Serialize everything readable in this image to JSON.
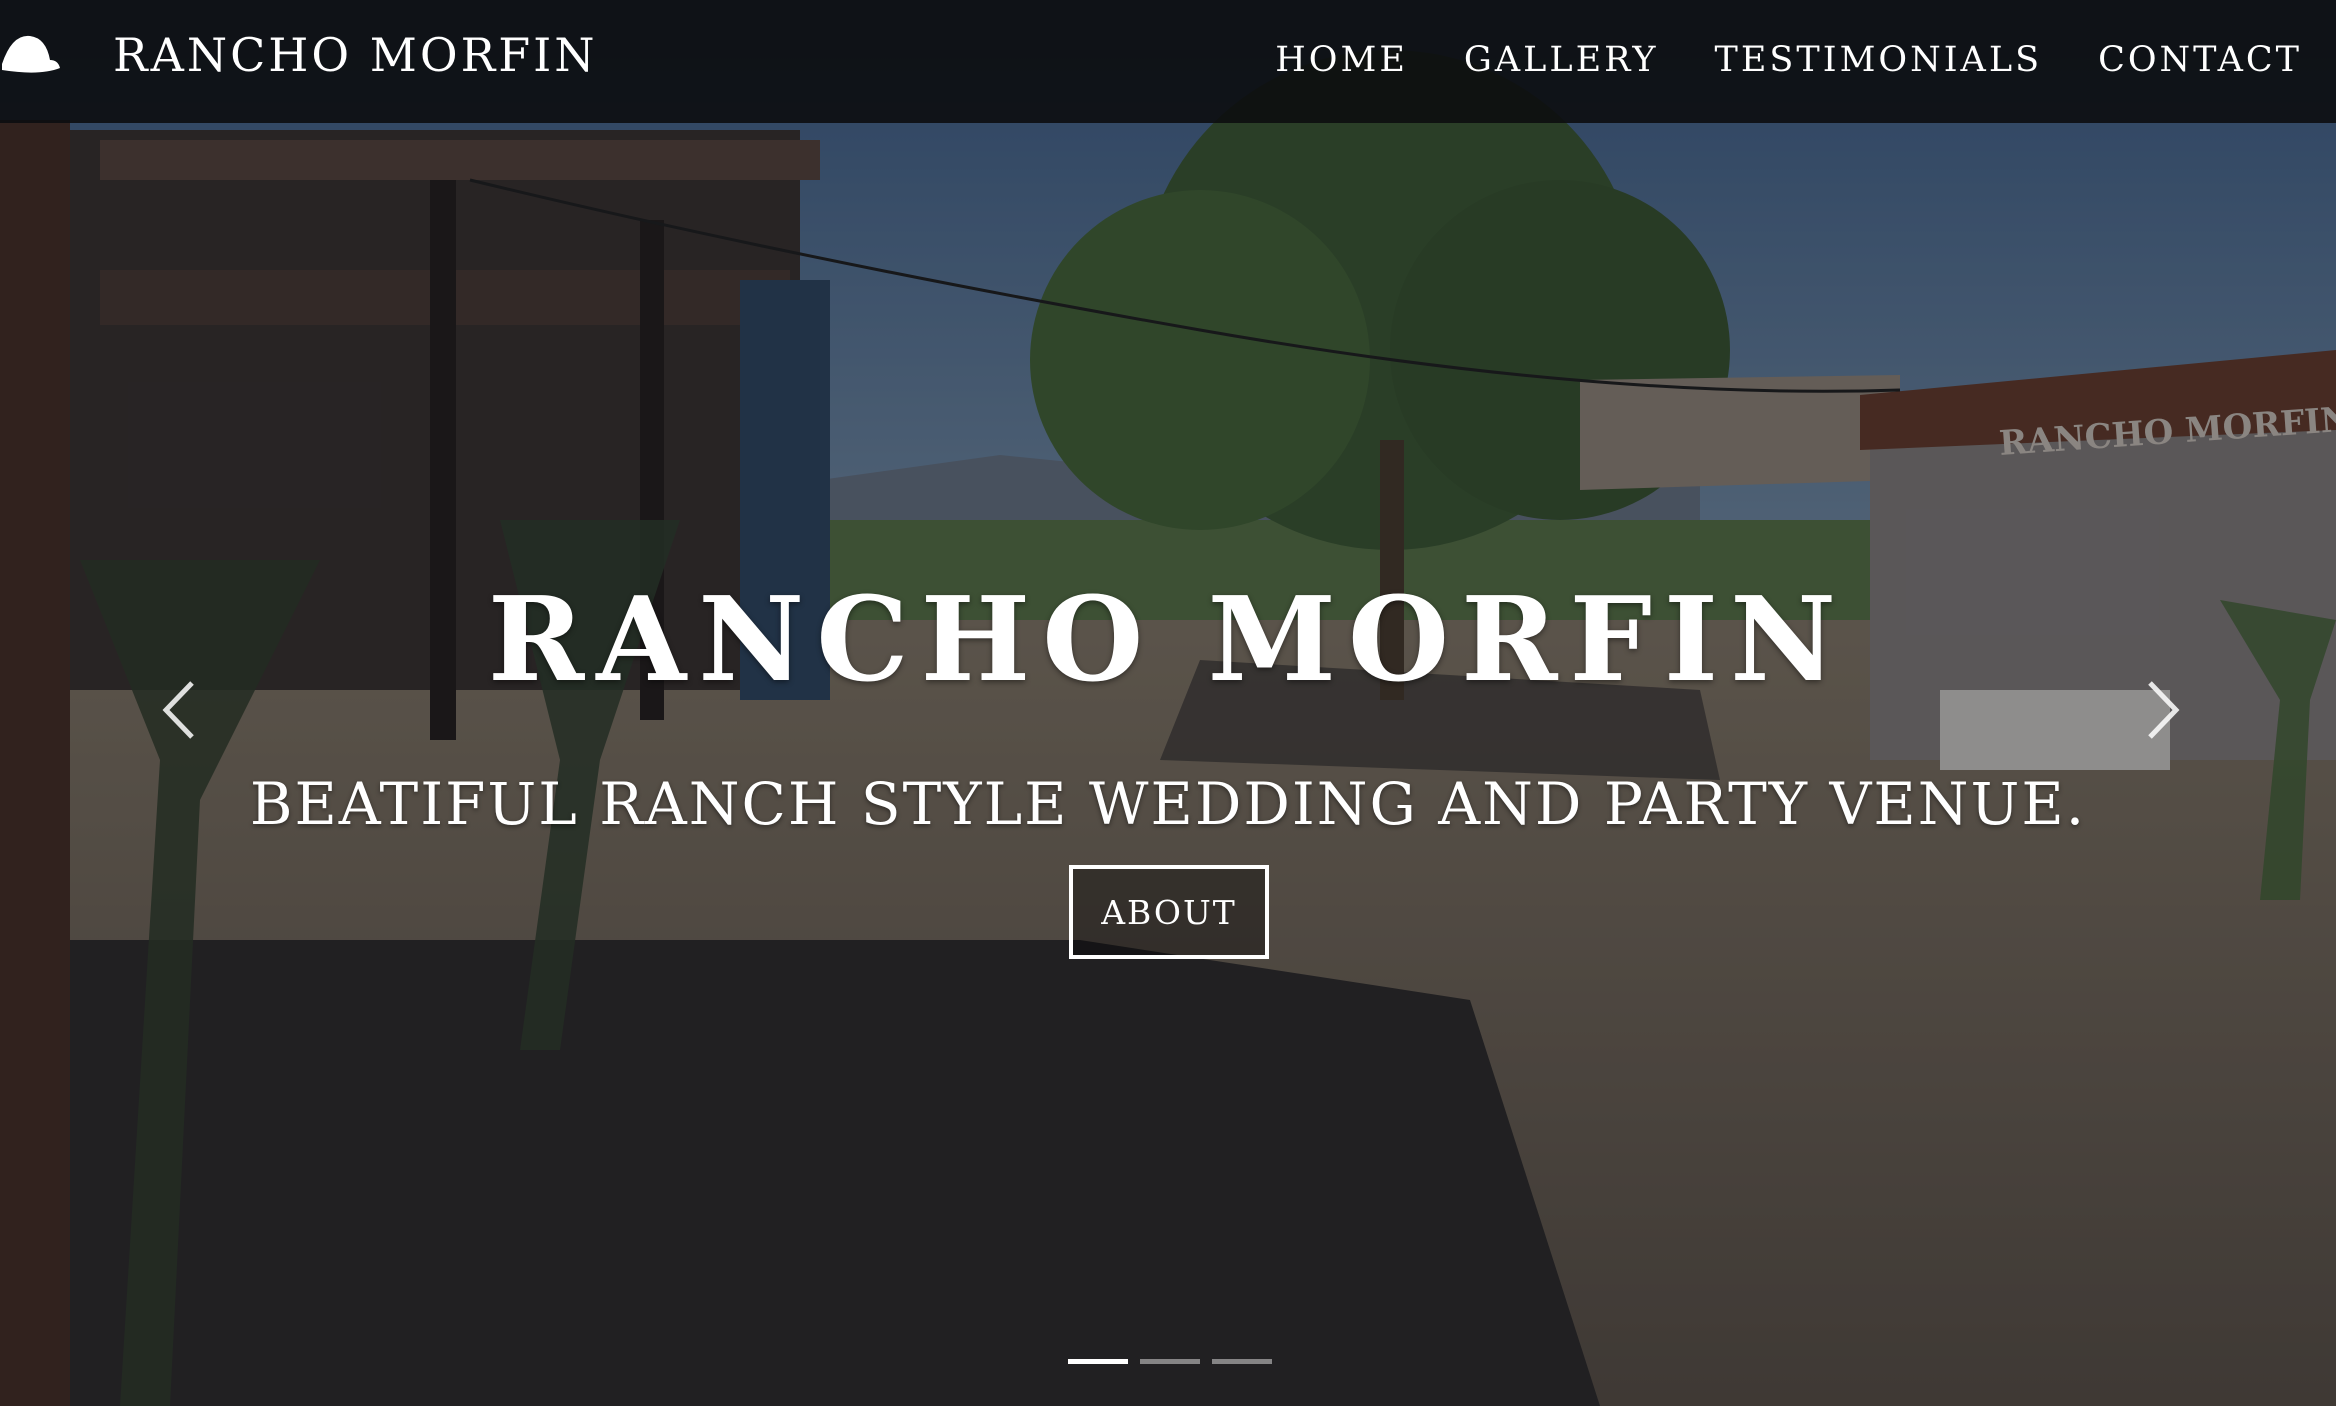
{
  "header": {
    "brand": "RANCHO MORFIN",
    "brand_icon": "cowboy-hat-icon",
    "nav": [
      {
        "label": "HOME"
      },
      {
        "label": "GALLERY"
      },
      {
        "label": "TESTIMONIALS"
      },
      {
        "label": "CONTACT"
      }
    ]
  },
  "hero": {
    "title": "RANCHO MORFIN",
    "subtitle": "BEATIFUL RANCH STYLE WEDDING AND PARTY VENUE.",
    "button_label": "ABOUT",
    "sign_text": "RANCHO MORFIN",
    "prev_icon": "chevron-left-icon",
    "next_icon": "chevron-right-icon",
    "slide_count": 3,
    "active_slide": 1
  },
  "colors": {
    "navbar": "#0c0d10",
    "text": "#ffffff"
  }
}
